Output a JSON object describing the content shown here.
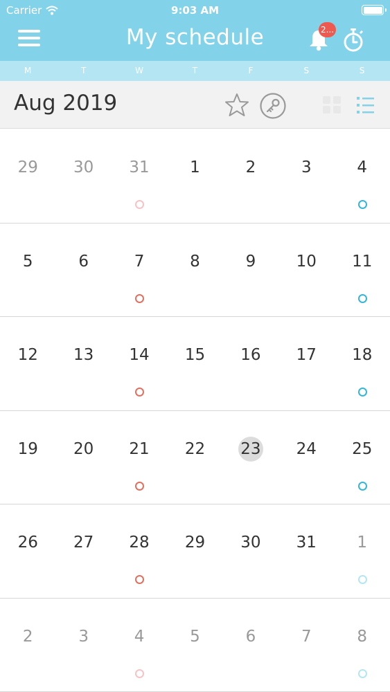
{
  "status": {
    "carrier": "Carrier",
    "time": "9:03 AM"
  },
  "nav": {
    "title": "My schedule",
    "badge": "2..."
  },
  "weekdays": [
    "M",
    "T",
    "W",
    "T",
    "F",
    "S",
    "S"
  ],
  "month_label": "Aug 2019",
  "colors": {
    "primary": "#82d3ea",
    "secondary": "#b3e5f2",
    "event_red": "#e07060",
    "event_blue": "#35b6d6",
    "badge": "#ee5a4f"
  },
  "weeks": [
    [
      {
        "n": "29",
        "other": true
      },
      {
        "n": "30",
        "other": true
      },
      {
        "n": "31",
        "other": true,
        "dot": "pink-light"
      },
      {
        "n": "1"
      },
      {
        "n": "2"
      },
      {
        "n": "3"
      },
      {
        "n": "4",
        "dot": "blue"
      }
    ],
    [
      {
        "n": "5"
      },
      {
        "n": "6"
      },
      {
        "n": "7",
        "dot": "red"
      },
      {
        "n": "8"
      },
      {
        "n": "9"
      },
      {
        "n": "10"
      },
      {
        "n": "11",
        "dot": "blue"
      }
    ],
    [
      {
        "n": "12"
      },
      {
        "n": "13"
      },
      {
        "n": "14",
        "dot": "red"
      },
      {
        "n": "15"
      },
      {
        "n": "16"
      },
      {
        "n": "17"
      },
      {
        "n": "18",
        "dot": "blue"
      }
    ],
    [
      {
        "n": "19"
      },
      {
        "n": "20"
      },
      {
        "n": "21",
        "dot": "red"
      },
      {
        "n": "22"
      },
      {
        "n": "23",
        "today": true
      },
      {
        "n": "24"
      },
      {
        "n": "25",
        "dot": "blue"
      }
    ],
    [
      {
        "n": "26"
      },
      {
        "n": "27"
      },
      {
        "n": "28",
        "dot": "red"
      },
      {
        "n": "29"
      },
      {
        "n": "30"
      },
      {
        "n": "31"
      },
      {
        "n": "1",
        "other": true,
        "dot": "blue-light"
      }
    ],
    [
      {
        "n": "2",
        "other": true
      },
      {
        "n": "3",
        "other": true
      },
      {
        "n": "4",
        "other": true,
        "dot": "pink-light"
      },
      {
        "n": "5",
        "other": true
      },
      {
        "n": "6",
        "other": true
      },
      {
        "n": "7",
        "other": true
      },
      {
        "n": "8",
        "other": true,
        "dot": "blue-light"
      }
    ]
  ]
}
